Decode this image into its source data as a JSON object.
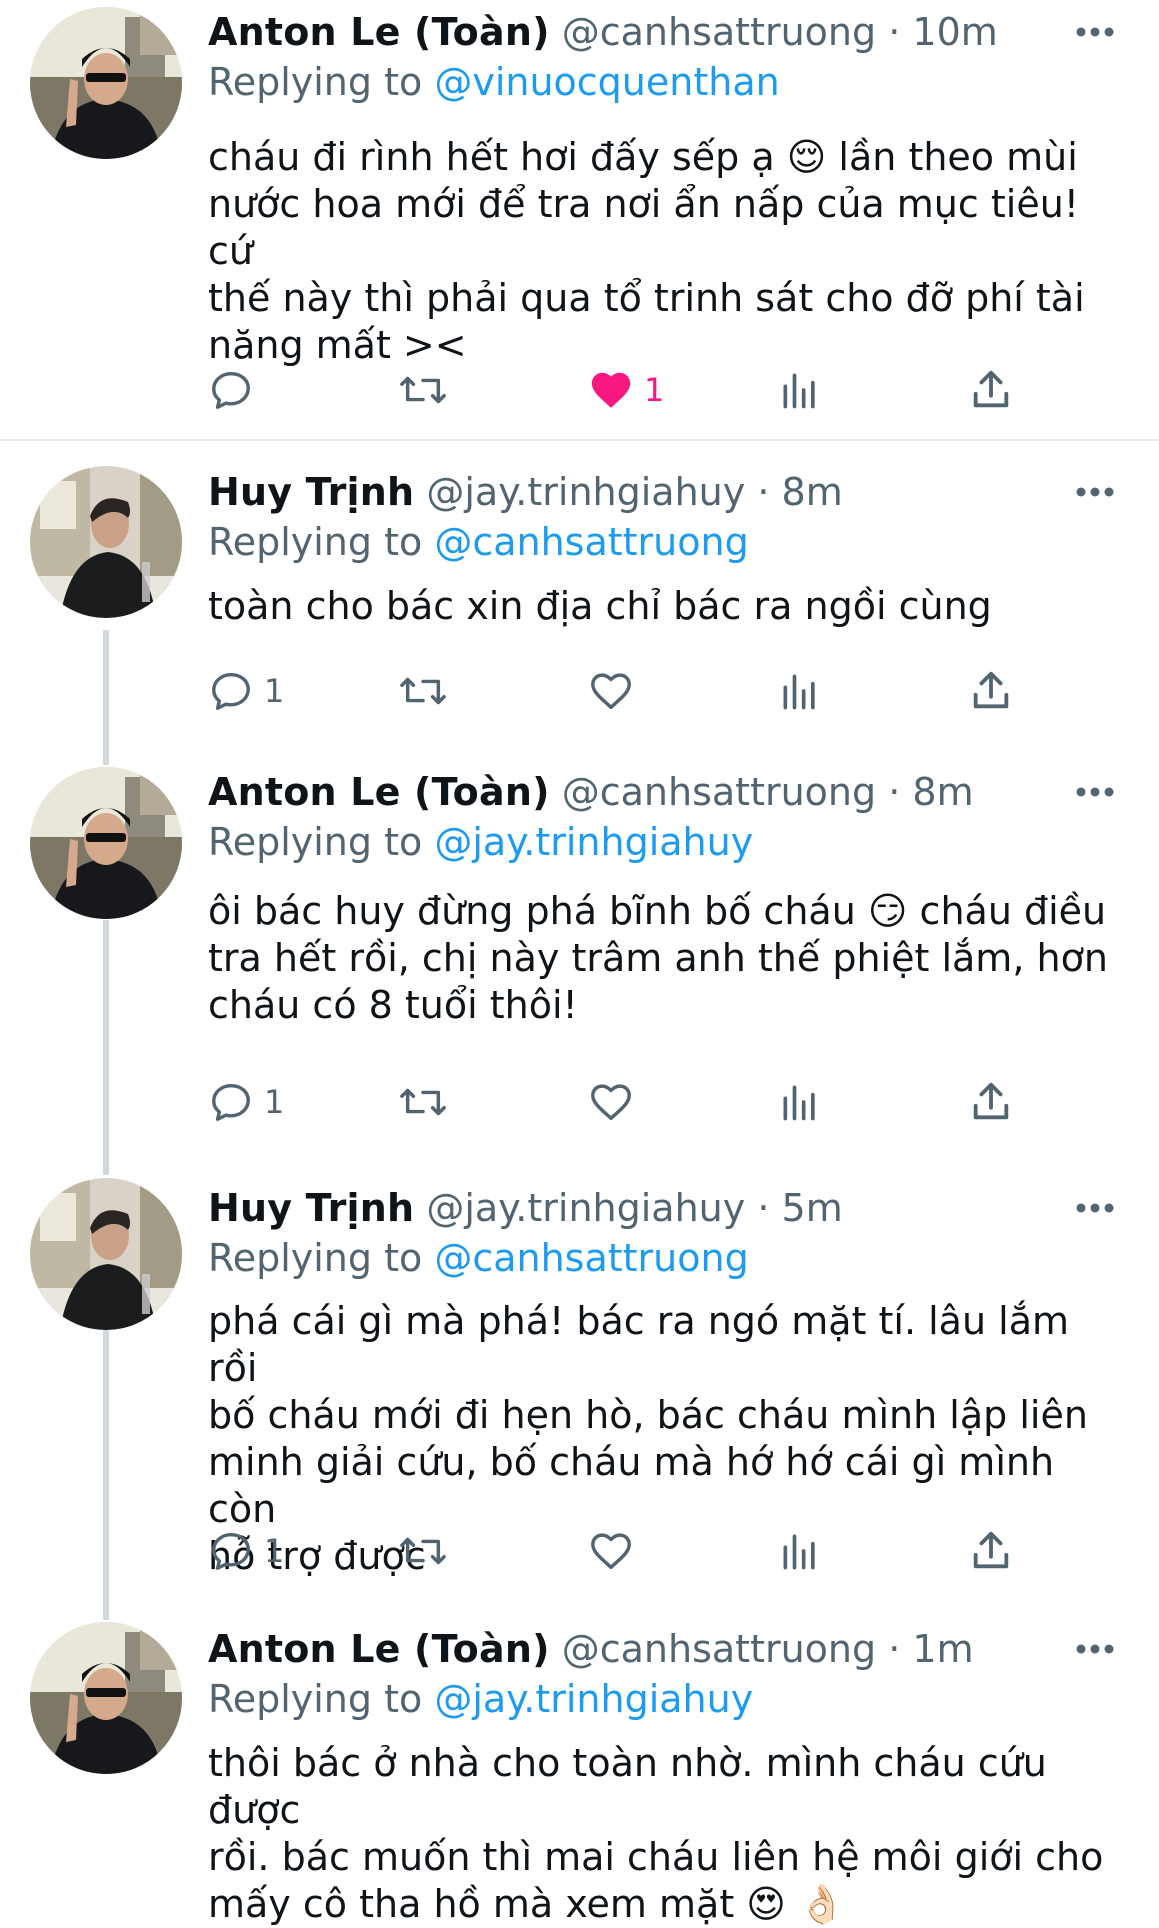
{
  "tweets": [
    {
      "name": "Anton Le (Toàn)",
      "handle": "@canhsattruong",
      "dot": "·",
      "time": "10m",
      "replying_prefix": "Replying to",
      "replying_to": "@vinuocquenthan",
      "text": "cháu đi rình hết hơi đấy sếp ạ 😌 lần theo mùi\nnước hoa mới để tra nơi ẩn nấp của mục tiêu! cứ\nthế này thì phải qua tổ trinh sát cho đỡ phí tài\nnăng mất ><",
      "reply_count": "",
      "retweet_count": "",
      "like_count": "1",
      "liked": true,
      "avatar": "avatar-anton"
    },
    {
      "name": "Huy Trịnh",
      "handle": "@jay.trinhgiahuy",
      "dot": "·",
      "time": "8m",
      "replying_prefix": "Replying to",
      "replying_to": "@canhsattruong",
      "text": "toàn cho bác xin địa chỉ bác ra ngồi cùng",
      "reply_count": "1",
      "retweet_count": "",
      "like_count": "",
      "liked": false,
      "avatar": "avatar-huy"
    },
    {
      "name": "Anton Le (Toàn)",
      "handle": "@canhsattruong",
      "dot": "·",
      "time": "8m",
      "replying_prefix": "Replying to",
      "replying_to": "@jay.trinhgiahuy",
      "text": "ôi bác huy đừng phá bĩnh bố cháu 😏 cháu điều\ntra hết rồi, chị này trâm anh thế phiệt lắm, hơn\ncháu có 8 tuổi thôi!",
      "reply_count": "1",
      "retweet_count": "",
      "like_count": "",
      "liked": false,
      "avatar": "avatar-anton"
    },
    {
      "name": "Huy Trịnh",
      "handle": "@jay.trinhgiahuy",
      "dot": "·",
      "time": "5m",
      "replying_prefix": "Replying to",
      "replying_to": "@canhsattruong",
      "text": "phá cái gì mà phá! bác ra ngó mặt tí. lâu lắm rồi\nbố cháu mới đi hẹn hò, bác cháu mình lập liên\nminh giải cứu, bố cháu mà hớ hớ cái gì mình còn\nhỗ trợ được",
      "reply_count": "1",
      "retweet_count": "",
      "like_count": "",
      "liked": false,
      "avatar": "avatar-huy"
    },
    {
      "name": "Anton Le (Toàn)",
      "handle": "@canhsattruong",
      "dot": "·",
      "time": "1m",
      "replying_prefix": "Replying to",
      "replying_to": "@jay.trinhgiahuy",
      "text": "thôi bác ở nhà cho toàn nhờ. mình cháu cứu được\nrồi. bác muốn thì mai cháu liên hệ môi giới cho\nmấy cô tha hồ mà xem mặt 😍 👌🏻",
      "reply_count": "",
      "retweet_count": "",
      "like_count": "",
      "liked": false,
      "avatar": "avatar-anton"
    }
  ],
  "colors": {
    "link": "#1d9bf0",
    "secondary": "#536471",
    "like": "#f91880",
    "thread_line": "#cfd9de"
  },
  "icons": {
    "reply": "reply-icon",
    "retweet": "retweet-icon",
    "like": "heart-icon",
    "analytics": "analytics-icon",
    "share": "share-icon",
    "more": "more-icon"
  }
}
